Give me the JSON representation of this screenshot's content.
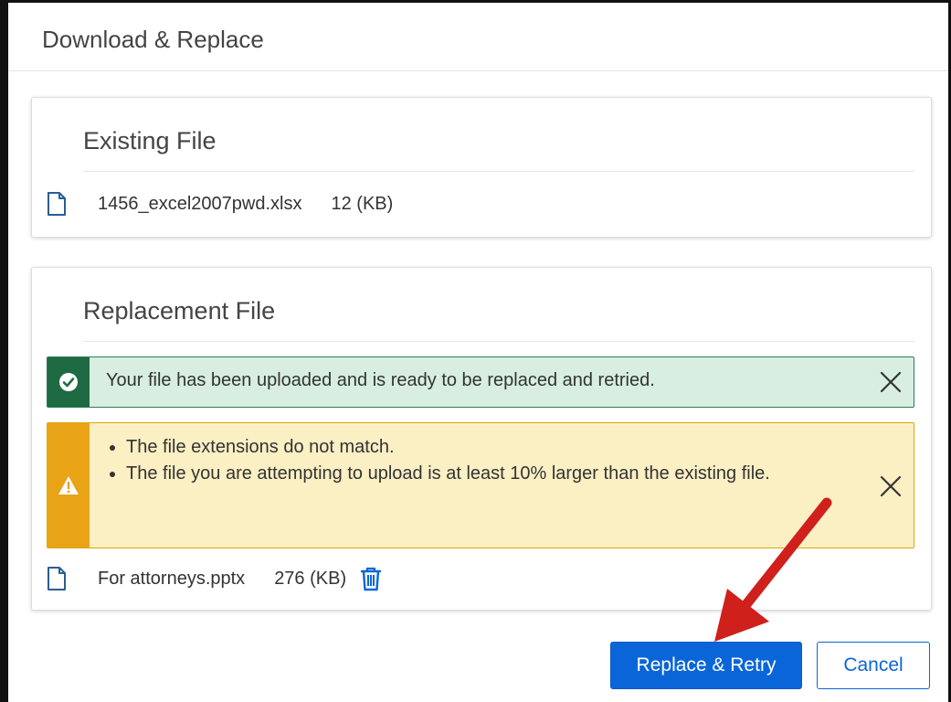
{
  "dialog": {
    "title": "Download & Replace"
  },
  "existing_file": {
    "heading": "Existing File",
    "file_name": "1456_excel2007pwd.xlsx",
    "file_size": "12 (KB)"
  },
  "replacement_file": {
    "heading": "Replacement File",
    "success_alert": {
      "message": "Your file has been uploaded and is ready to be replaced and retried."
    },
    "warning_alert": {
      "items": [
        "The file extensions do not match.",
        "The file you are attempting to upload is at least 10% larger than the existing file."
      ]
    },
    "file_name": "For attorneys.pptx",
    "file_size": "276 (KB)"
  },
  "actions": {
    "primary_label": "Replace & Retry",
    "secondary_label": "Cancel"
  },
  "icons": {
    "success": "check-circle-icon",
    "warning": "warning-triangle-icon",
    "close": "close-icon",
    "file": "document-icon",
    "delete": "trash-icon"
  },
  "colors": {
    "primary": "#0a66d8",
    "success_bar": "#1e6b43",
    "success_bg": "#d7eee0",
    "warning_bar": "#e8a317",
    "warning_bg": "#fbefc4",
    "annotation_arrow": "#d0201c"
  }
}
